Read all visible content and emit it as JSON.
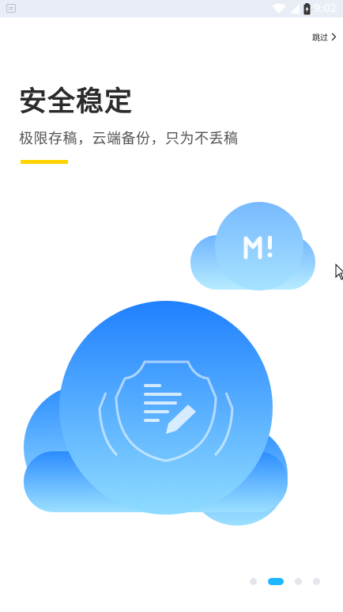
{
  "status_bar": {
    "time": "9:02",
    "icons": [
      "notification-icon",
      "wifi-icon",
      "signal-icon",
      "battery-charging-icon"
    ]
  },
  "skip": {
    "label": "跳过",
    "icon": "chevron-right-icon"
  },
  "headline": {
    "title": "安全稳定",
    "subtitle": "极限存稿，云端备份，只为不丢稿",
    "accent_color": "#ffd400"
  },
  "illustration": {
    "main_icon": "shield-document-edit-icon",
    "small_icon": "app-logo-icon",
    "logo_text": "M!",
    "colors": {
      "blue": "#1f86ff",
      "light_blue": "#8fd8ff"
    }
  },
  "pager": {
    "count": 4,
    "active_index": 1,
    "active_color": "#1eb6ff"
  }
}
